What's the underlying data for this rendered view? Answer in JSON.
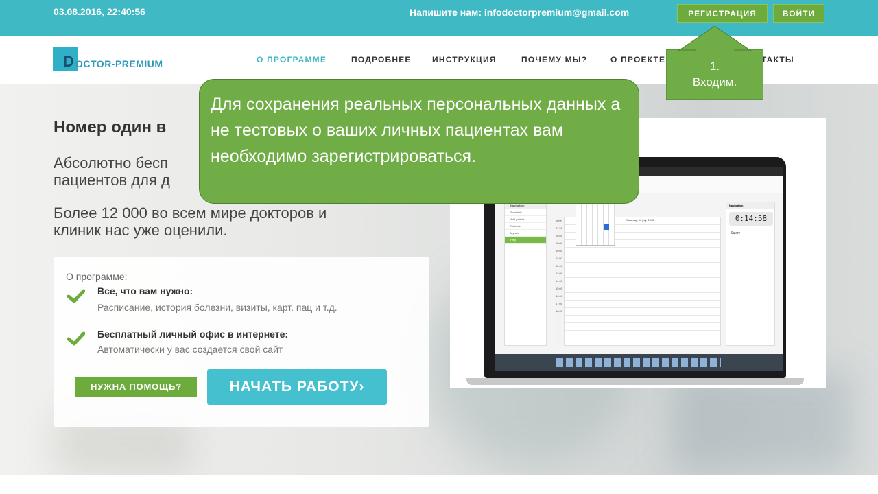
{
  "topbar": {
    "datetime": "03.08.2016, 22:40:56",
    "contact": "Напишите нам: infodoctorpremium@gmail.com",
    "register_label": "РЕГИСТРАЦИЯ",
    "login_label": "ВОЙТИ",
    "bg_color": "#3fbac4"
  },
  "logo": {
    "letter": "D",
    "text": "OCTOR-PREMIUM"
  },
  "nav": {
    "items": [
      {
        "label": "О ПРОГРАММЕ",
        "active": true
      },
      {
        "label": "ПОДРОБНЕЕ"
      },
      {
        "label": "ИНСТРУКЦИЯ"
      },
      {
        "label": "ПОЧЕМУ МЫ?"
      },
      {
        "label": "О ПРОЕКТЕ"
      },
      {
        "label": "НТАКТЫ"
      }
    ],
    "active_color": "#3fbac4"
  },
  "hero": {
    "headline": "Номер один в",
    "subtitle_line1": "Абсолютно бесп",
    "subtitle_line2": "пациентов для д",
    "stat_line1": "Более 12 000 во всем мире докторов и",
    "stat_line2": "клиник нас уже оценили."
  },
  "card": {
    "label": "О программе:",
    "features": [
      {
        "title": "Все, что вам нужно:",
        "desc": "Расписание, история болезни, визиты, карт. пац и т.д."
      },
      {
        "title": "Бесплатный личный офис в интернете:",
        "desc": "Автоматически у вас создается свой сайт"
      }
    ],
    "help_label": "НУЖНА ПОМОЩЬ?",
    "start_label": "НАЧАТЬ РАБОТУ",
    "start_arrow": "›",
    "accent_green": "#6cab3c",
    "accent_teal": "#45c0cf"
  },
  "laptop": {
    "clock": "0:14:58",
    "sidebar_title": "Navigation",
    "sidebar_items": [
      "Schedule",
      "Add patient",
      "Patients",
      "My site",
      "Help"
    ],
    "day_title": "Saturday, 16 july, 2016",
    "right_title": "Navigation",
    "right_item": "Salary",
    "times": [
      "Time",
      "07:00",
      "08:00",
      "09:00",
      "10:00",
      "11:00",
      "12:00",
      "13:00",
      "14:00",
      "15:00",
      "16:00",
      "17:00",
      "18:00"
    ]
  },
  "callouts": {
    "main_text": "Для сохранения реальных персональных данных а не тестовых о ваших личных пациентах вам необходимо зарегистрироваться.",
    "arrow_text_line1": "1.",
    "arrow_text_line2": "Входим.",
    "fill_color": "#70ad47"
  }
}
